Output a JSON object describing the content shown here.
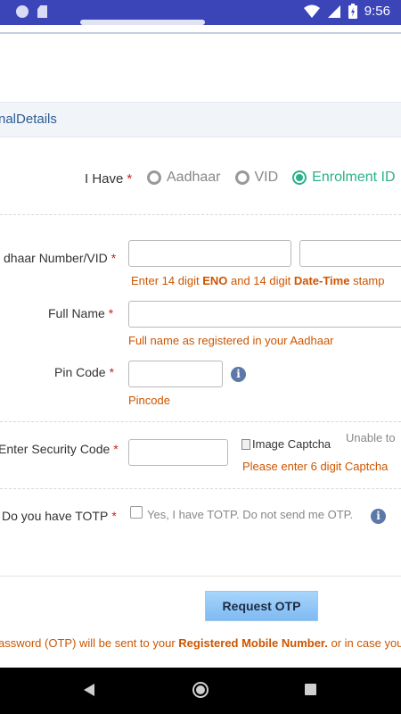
{
  "status_bar": {
    "time": "9:56",
    "icons": [
      "app-dot-icon",
      "sd-card-icon",
      "wifi-icon",
      "signal-icon",
      "battery-icon"
    ]
  },
  "section": {
    "title": "nalDetails"
  },
  "i_have": {
    "label": "I Have",
    "required_mark": "*",
    "options": [
      {
        "label": "Aadhaar",
        "selected": false
      },
      {
        "label": "VID",
        "selected": false
      },
      {
        "label": "Enrolment ID",
        "selected": true
      }
    ]
  },
  "aadhaar_number": {
    "label": "dhaar Number/VID",
    "required_mark": "*",
    "hint_prefix": "Enter 14 digit ",
    "hint_bold1": "ENO",
    "hint_mid": " and 14 digit ",
    "hint_bold2": "Date-Time",
    "hint_suffix": " stamp",
    "value1": "",
    "value2": ""
  },
  "full_name": {
    "label": "Full Name",
    "required_mark": "*",
    "hint": "Full name as registered in your Aadhaar",
    "value": ""
  },
  "pin_code": {
    "label": "Pin Code",
    "required_mark": "*",
    "hint": "Pincode",
    "value": ""
  },
  "security_code": {
    "label": "Enter Security Code",
    "required_mark": "*",
    "captcha_alt": "Image Captcha",
    "captcha_note": "Unable to",
    "hint": "Please enter 6 digit Captcha",
    "value": ""
  },
  "totp": {
    "label": "Do you have TOTP",
    "required_mark": "*",
    "checkbox_label": "Yes, I have TOTP. Do not send me OTP.",
    "checked": false
  },
  "request_otp": {
    "label": "Request OTP"
  },
  "footer": {
    "prefix": "assword (OTP) will be sent to your ",
    "bold": "Registered Mobile Number.",
    "suffix": " or in case you"
  },
  "colors": {
    "status_bar": "#3b45b8",
    "accent_green": "#2bb08a",
    "hint_orange": "#cc5500",
    "required_red": "#cc2222",
    "section_text": "#2d5b93"
  }
}
